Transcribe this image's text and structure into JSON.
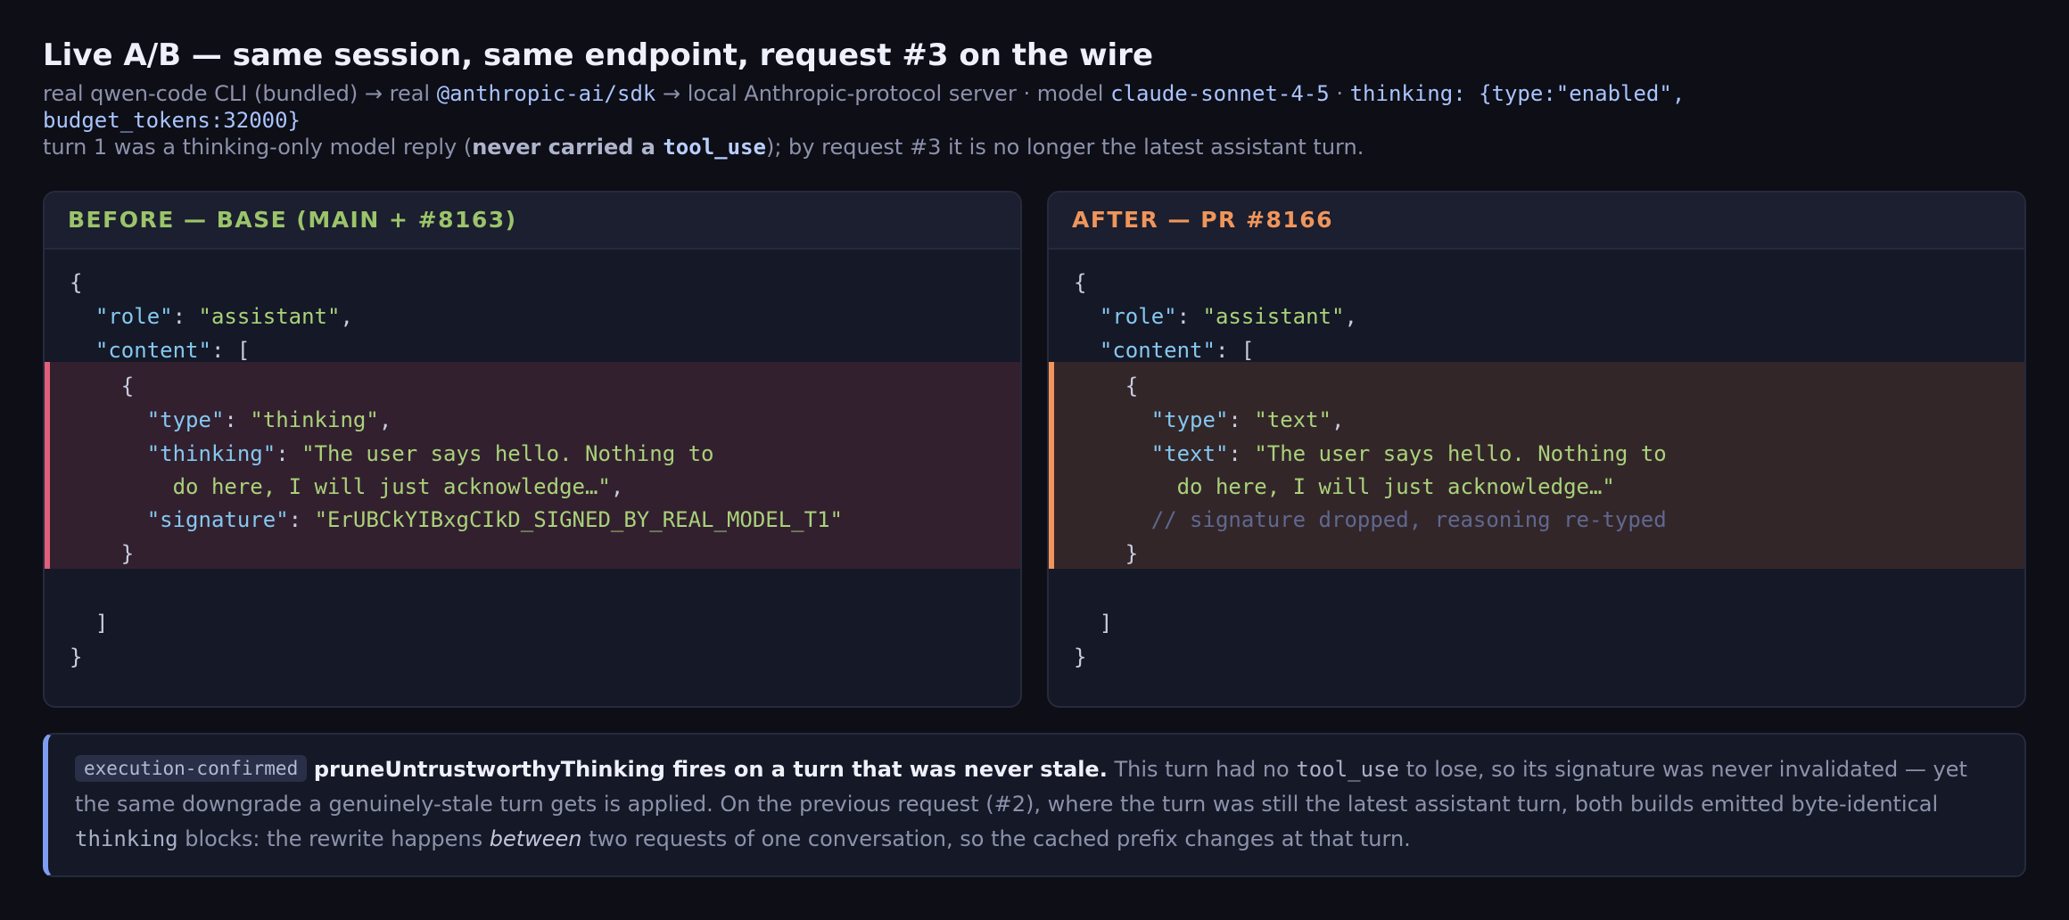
{
  "header": {
    "title": "Live A/B — same session, same endpoint, request #3 on the wire",
    "sub1_a": "real qwen-code CLI (bundled) → real ",
    "sub1_sdk": "@anthropic-ai/sdk",
    "sub1_b": " → local Anthropic-protocol server · model ",
    "sub1_model": "claude-sonnet-4-5",
    "sub1_c": " · ",
    "sub1_thinking": "thinking: {type:\"enabled\",",
    "sub2_thinking": "budget_tokens:32000}",
    "sub3_a": "turn 1 was a thinking-only model reply (",
    "sub3_bold": "never carried a ",
    "sub3_code": "tool_use",
    "sub3_b": "); by request #3 it is no longer the latest assistant turn."
  },
  "before": {
    "heading": "BEFORE — BASE (MAIN + #8163)",
    "open_brace": "{",
    "role_key": "\"role\"",
    "role_val": "\"assistant\"",
    "content_key": "\"content\"",
    "inner_open": "{",
    "type_key": "\"type\"",
    "type_val": "\"thinking\"",
    "thinking_key": "\"thinking\"",
    "thinking_val_1": "\"The user says hello. Nothing to",
    "thinking_val_2": "do here, I will just acknowledge…\"",
    "signature_key": "\"signature\"",
    "signature_val": "\"ErUBCkYIBxgCIkD_SIGNED_BY_REAL_MODEL_T1\"",
    "inner_close": "}",
    "array_close": "]",
    "close_brace": "}"
  },
  "after": {
    "heading": "AFTER — PR #8166",
    "open_brace": "{",
    "role_key": "\"role\"",
    "role_val": "\"assistant\"",
    "content_key": "\"content\"",
    "inner_open": "{",
    "type_key": "\"type\"",
    "type_val": "\"text\"",
    "text_key": "\"text\"",
    "text_val_1": "\"The user says hello. Nothing to",
    "text_val_2": "do here, I will just acknowledge…\"",
    "comment": "// signature dropped, reasoning re-typed",
    "inner_close": "}",
    "array_close": "]",
    "close_brace": "}"
  },
  "note": {
    "badge": "execution-confirmed",
    "lead": "pruneUntrustworthyThinking fires on a turn that was never stale.",
    "t1": " This turn had no ",
    "c1": "tool_use",
    "t2": " to lose, so its signature was never invalidated — yet the same downgrade a genuinely-stale turn gets is applied. On the previous request (#2), where the turn was still the latest assistant turn, both builds emitted byte-identical ",
    "c2": "thinking",
    "t3": " blocks: the rewrite happens ",
    "em": "between",
    "t4": " two requests of one conversation, so the cached prefix changes at that turn."
  },
  "colors": {
    "background": "#0d0e16",
    "before_accent": "#9bc46b",
    "before_bar": "#e0607a",
    "after_accent": "#f0955b",
    "note_bar": "#7d9df0"
  }
}
